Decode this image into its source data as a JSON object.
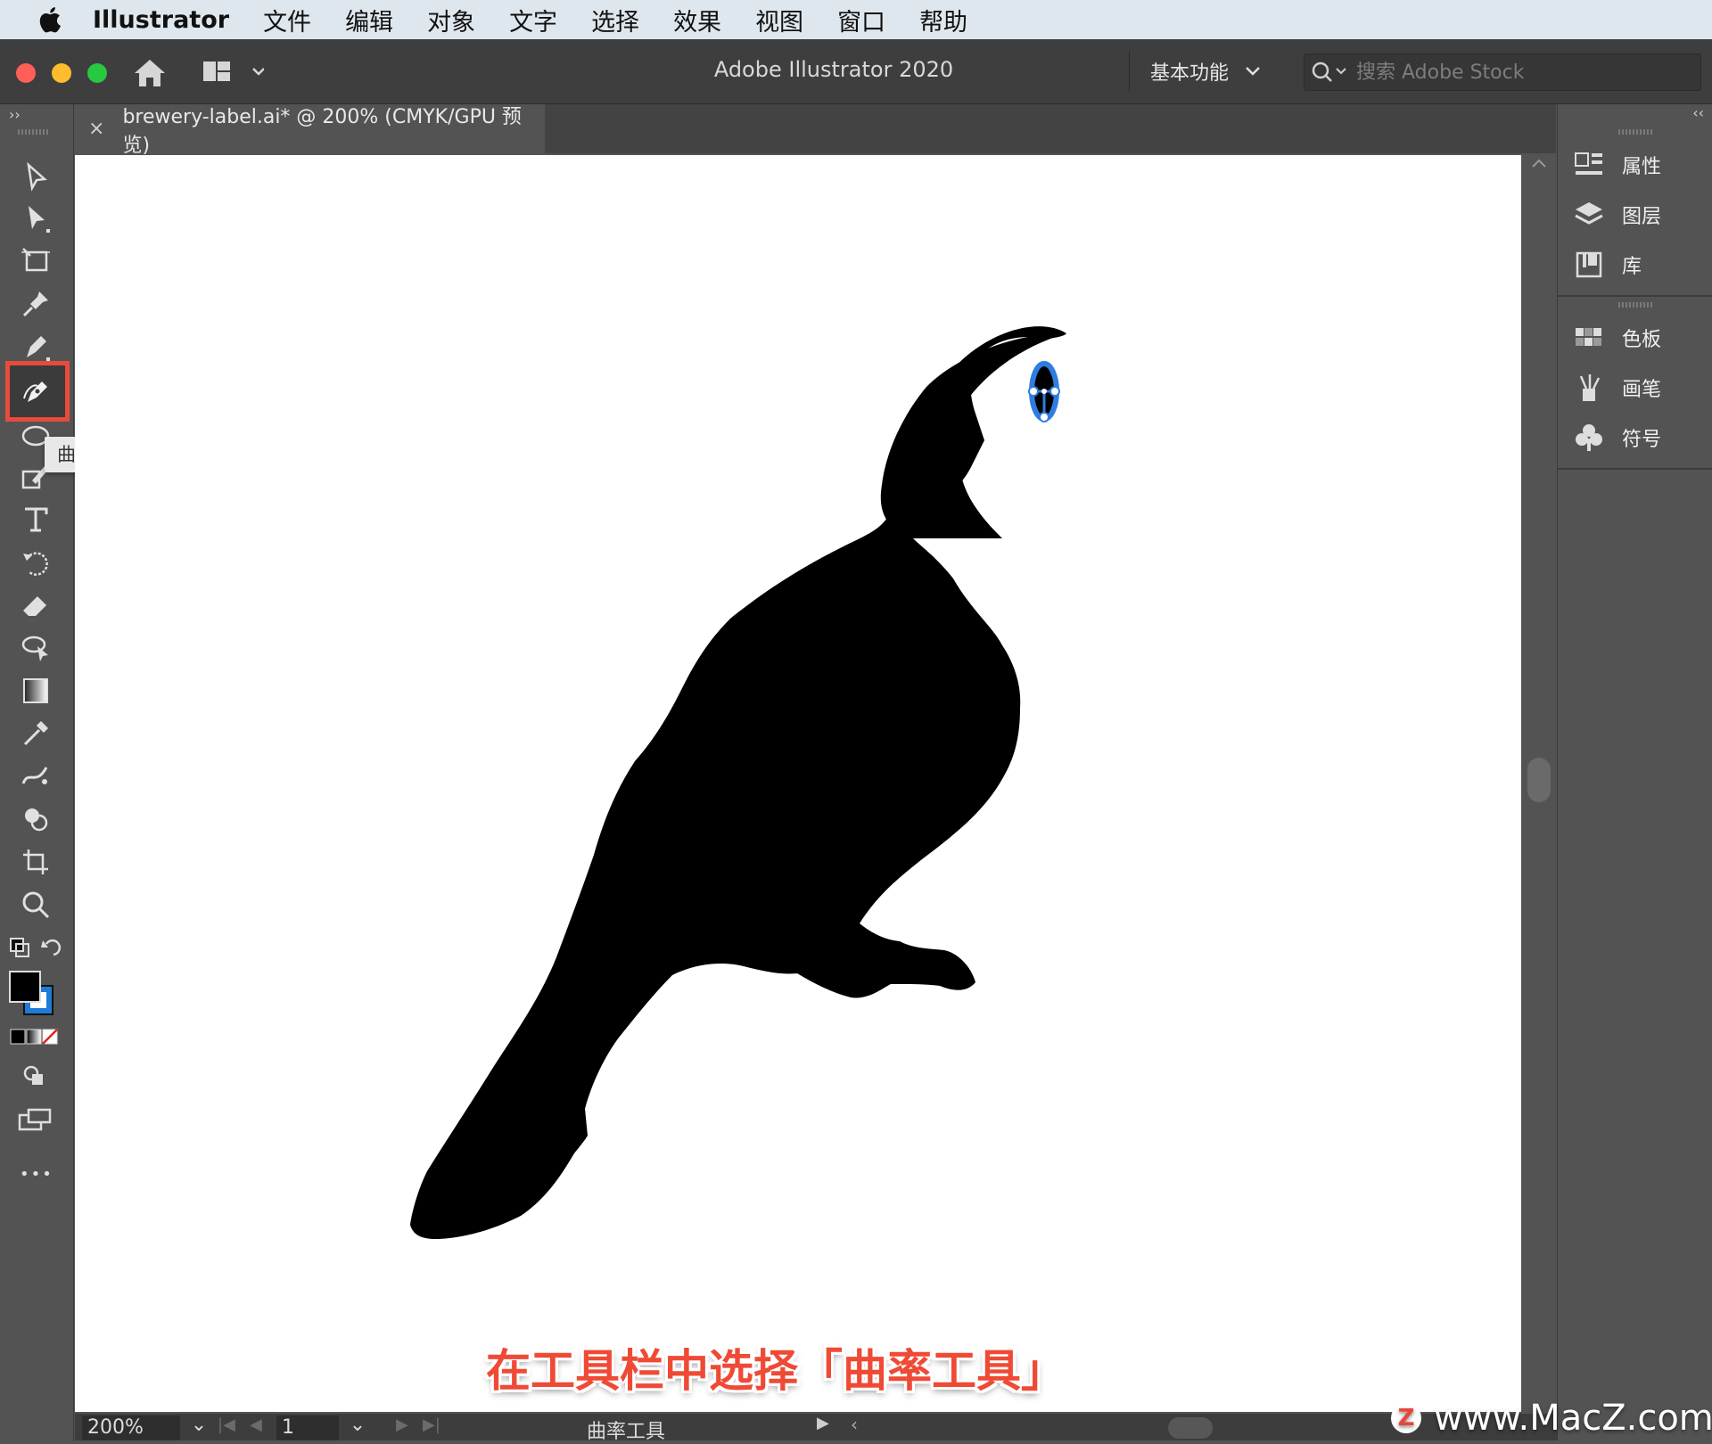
{
  "menubar": {
    "app_name": "Illustrator",
    "items": [
      "文件",
      "编辑",
      "对象",
      "文字",
      "选择",
      "效果",
      "视图",
      "窗口",
      "帮助"
    ]
  },
  "titlebar": {
    "app_title": "Adobe Illustrator 2020",
    "workspace": "基本功能",
    "search_placeholder": "搜索 Adobe Stock"
  },
  "document": {
    "tab_title": "brewery-label.ai* @ 200% (CMYK/GPU 预览)",
    "close_glyph": "×"
  },
  "toolbar": {
    "collapse_glyph": "››",
    "tooltip": "曲率工具 (Shift+`)",
    "more_glyph": "•••",
    "tools": [
      "selection-tool-icon",
      "direct-selection-tool-icon",
      "artboard-tool-icon",
      "puppet-warp-icon",
      "pen-tool-icon",
      "curvature-tool-icon",
      "ellipse-tool-icon",
      "shaper-tool-icon",
      "type-tool-icon",
      "rotate-tool-icon",
      "eraser-tool-icon",
      "lasso-tool-icon",
      "gradient-tool-icon",
      "eyedropper-tool-icon",
      "symbol-sprayer-icon",
      "shape-builder-icon",
      "crop-tool-icon",
      "zoom-tool-icon"
    ]
  },
  "right_panel": {
    "collapse_glyph": "‹‹",
    "group1": [
      "属性",
      "图层",
      "库"
    ],
    "group2": [
      "色板",
      "画笔",
      "符号"
    ]
  },
  "statusbar": {
    "zoom": "200%",
    "page": "1",
    "current_tool": "曲率工具",
    "dropdown_glyph": "⌄",
    "play_glyph": "▶",
    "back_glyph": "‹",
    "first_glyph": "|◀",
    "prev_glyph": "◀",
    "next_glyph": "▶",
    "last_glyph": "▶|"
  },
  "overlay": {
    "caption": "在工具栏中选择「曲率工具」",
    "watermark": "www.MacZ.com",
    "watermark_logo": "Z"
  },
  "colors": {
    "highlight_border": "#e84a3c",
    "selection_blue": "#2f7de1",
    "fill": "#000000",
    "stroke": "#1f7bd6"
  }
}
